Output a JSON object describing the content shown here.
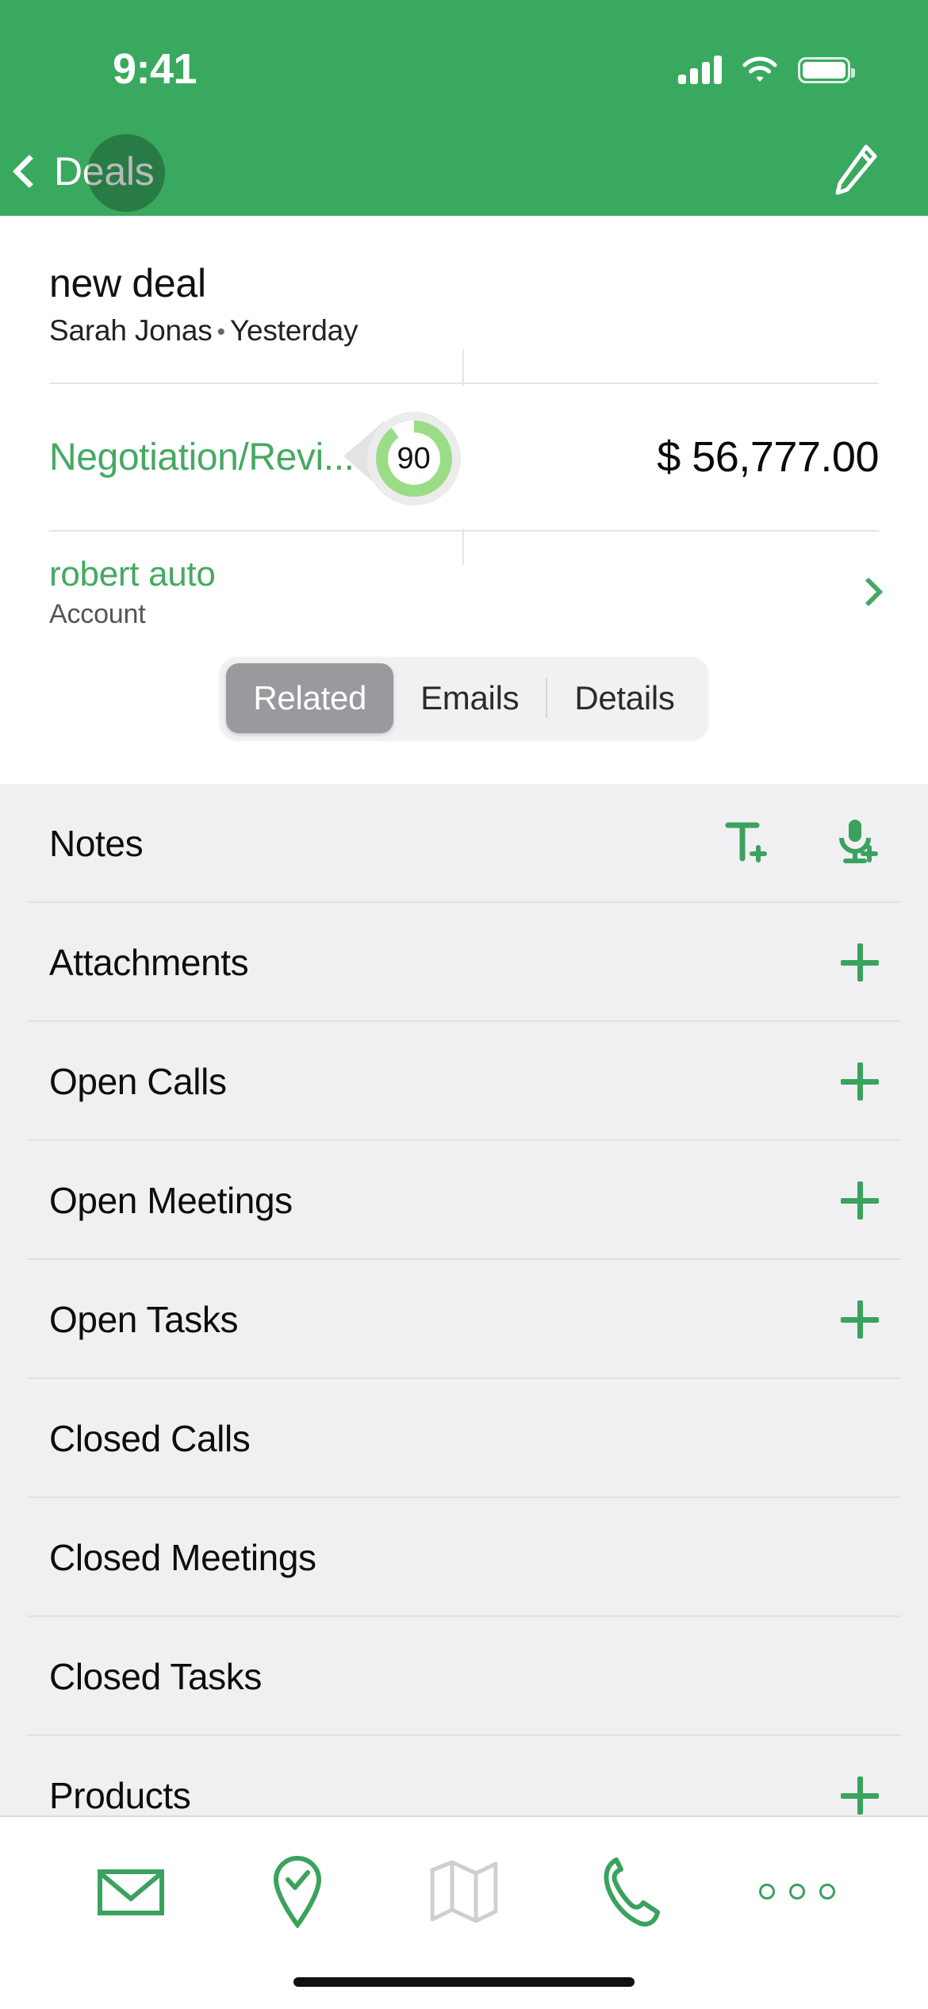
{
  "status_bar": {
    "time": "9:41",
    "signal_icon": "cellular-signal-icon",
    "wifi_icon": "wifi-icon",
    "battery_icon": "battery-icon"
  },
  "nav_bar": {
    "back_label": "Deals",
    "back_icon": "chevron-left-icon",
    "edit_icon": "pencil-edit-icon",
    "background_color": "#39A95F"
  },
  "deal": {
    "title": "new deal",
    "owner": "Sarah Jonas",
    "separator": "•",
    "modified": "Yesterday",
    "stage": "Negotiation/Revi...",
    "probability": "90",
    "probability_percent": 90,
    "amount": "$ 56,777.00",
    "account_name": "robert auto",
    "account_label": "Account",
    "account_chevron_icon": "chevron-right-icon",
    "stage_color": "#45A963",
    "gauge_arc_color": "#9BDC87",
    "gauge_track_color": "#E3E3E3"
  },
  "tabs": {
    "items": [
      {
        "label": "Related",
        "active": true
      },
      {
        "label": "Emails",
        "active": false
      },
      {
        "label": "Details",
        "active": false
      }
    ]
  },
  "related_list": {
    "rows": [
      {
        "label": "Notes",
        "actions": [
          "add-text-note-icon",
          "add-voice-note-icon"
        ]
      },
      {
        "label": "Attachments",
        "actions": [
          "plus-icon"
        ]
      },
      {
        "label": "Open Calls",
        "actions": [
          "plus-icon"
        ]
      },
      {
        "label": "Open Meetings",
        "actions": [
          "plus-icon"
        ]
      },
      {
        "label": "Open Tasks",
        "actions": [
          "plus-icon"
        ]
      },
      {
        "label": "Closed Calls",
        "actions": []
      },
      {
        "label": "Closed Meetings",
        "actions": []
      },
      {
        "label": "Closed Tasks",
        "actions": []
      },
      {
        "label": "Products",
        "actions": [
          "plus-icon"
        ]
      }
    ]
  },
  "toolbar": {
    "items": [
      {
        "icon": "email-envelope-icon",
        "enabled": true
      },
      {
        "icon": "check-in-pin-icon",
        "enabled": true
      },
      {
        "icon": "map-icon",
        "enabled": false
      },
      {
        "icon": "phone-call-icon",
        "enabled": true
      },
      {
        "icon": "more-options-icon",
        "enabled": true
      }
    ],
    "accent_color": "#3BA25E",
    "disabled_color": "#CFCFCF"
  }
}
